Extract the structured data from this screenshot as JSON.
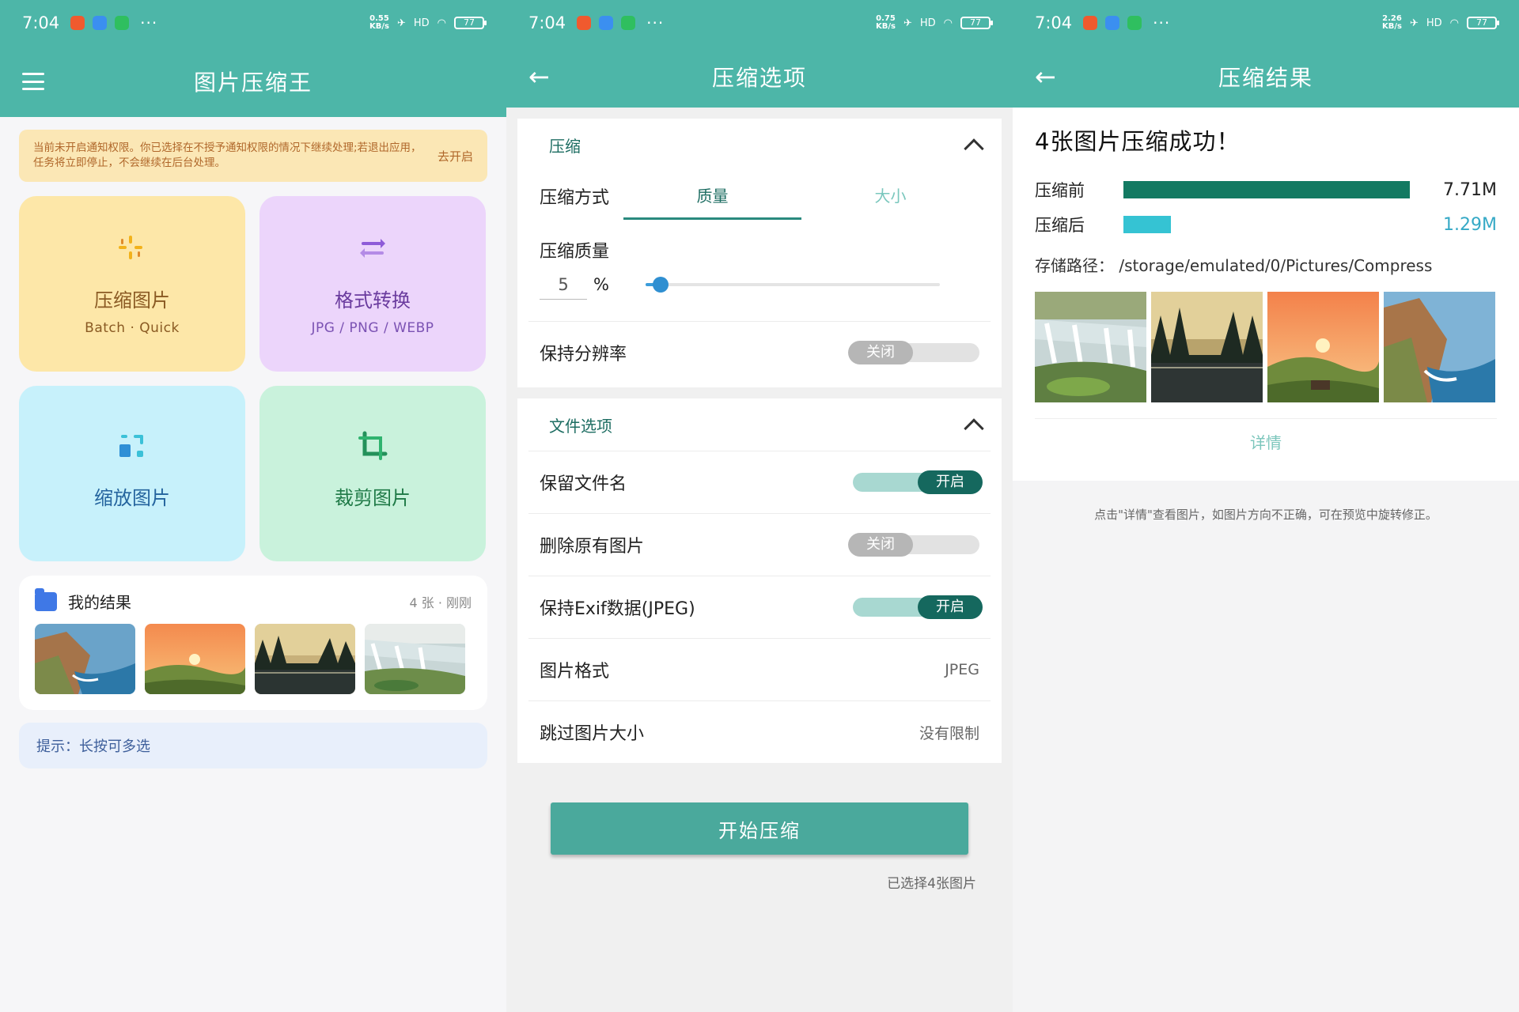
{
  "status": {
    "time": "7:04",
    "dots": "···",
    "battery": "77",
    "speeds": [
      "0.55\nKB/s",
      "0.75\nKB/s",
      "2.26\nKB/s"
    ],
    "signal": "HD",
    "app_icon_colors": [
      "#f05a2e",
      "#3b8ff0",
      "#2fbf5f"
    ]
  },
  "screen1": {
    "title": "图片压缩王",
    "notice": {
      "text": "当前未开启通知权限。你已选择在不授予通知权限的情况下继续处理;若退出应用，任务将立即停止，不会继续在后台处理。",
      "action": "去开启"
    },
    "tiles": [
      {
        "title": "压缩图片",
        "sub": "Batch · Quick",
        "icon": "sparkle-compress-icon"
      },
      {
        "title": "格式转换",
        "sub": "JPG / PNG / WEBP",
        "icon": "convert-arrows-icon"
      },
      {
        "title": "缩放图片",
        "sub": "",
        "icon": "resize-icon"
      },
      {
        "title": "裁剪图片",
        "sub": "",
        "icon": "crop-icon"
      }
    ],
    "results": {
      "title": "我的结果",
      "meta": "4 张 · 刚刚",
      "thumbs": [
        "coast",
        "sunset",
        "forest-lake",
        "waterfall"
      ]
    },
    "tip": "提示：长按可多选"
  },
  "screen2": {
    "title": "压缩选项",
    "compress_section": {
      "title": "压缩",
      "method_label": "压缩方式",
      "method_options": [
        "质量",
        "大小"
      ],
      "method_selected": "质量",
      "quality_label": "压缩质量",
      "quality_value": "5",
      "quality_unit": "%",
      "quality_fraction": 0.05,
      "keep_resolution_label": "保持分辨率",
      "keep_resolution_state": "关闭"
    },
    "file_section": {
      "title": "文件选项",
      "keep_filename_label": "保留文件名",
      "keep_filename_state": "开启",
      "delete_original_label": "删除原有图片",
      "delete_original_state": "关闭",
      "keep_exif_label": "保持Exif数据(JPEG)",
      "keep_exif_state": "开启",
      "format_label": "图片格式",
      "format_value": "JPEG",
      "skip_size_label": "跳过图片大小",
      "skip_size_value": "没有限制"
    },
    "start_button": "开始压缩",
    "selected_note": "已选择4张图片"
  },
  "screen3": {
    "title": "压缩结果",
    "headline": "4张图片压缩成功！",
    "before_label": "压缩前",
    "before_value": "7.71M",
    "before_fraction": 1.0,
    "after_label": "压缩后",
    "after_value": "1.29M",
    "after_fraction": 0.167,
    "path_label": "存储路径：",
    "path_value": "/storage/emulated/0/Pictures/Compress",
    "photos": [
      "waterfall",
      "forest-lake",
      "sunset",
      "coast"
    ],
    "detail_link": "详情",
    "hint": "点击\"详情\"查看图片，如图片方向不正确，可在预览中旋转修正。",
    "colors": {
      "before_bar": "#137a62",
      "after_bar": "#35c3d3",
      "after_value": "#35a9c6"
    }
  }
}
